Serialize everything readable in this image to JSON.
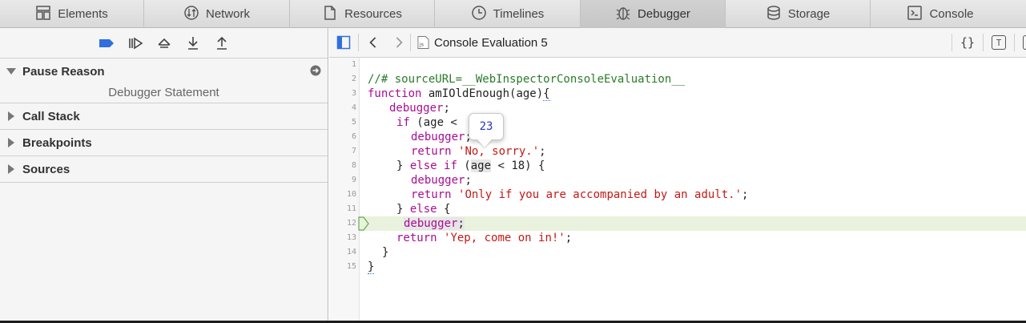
{
  "tabs": [
    {
      "label": "Elements",
      "icon": "elements-icon"
    },
    {
      "label": "Network",
      "icon": "network-icon"
    },
    {
      "label": "Resources",
      "icon": "resources-icon"
    },
    {
      "label": "Timelines",
      "icon": "timelines-icon"
    },
    {
      "label": "Debugger",
      "icon": "debugger-icon",
      "active": true
    },
    {
      "label": "Storage",
      "icon": "storage-icon"
    },
    {
      "label": "Console",
      "icon": "console-icon"
    }
  ],
  "sidebar": {
    "pause_reason": {
      "label": "Pause Reason",
      "detail": "Debugger Statement"
    },
    "sections": [
      "Call Stack",
      "Breakpoints",
      "Sources"
    ]
  },
  "editor": {
    "file_title": "Console Evaluation 5",
    "popover_value": "23",
    "current_line": 12,
    "line_numbers": [
      "1",
      "2",
      "3",
      "4",
      "5",
      "6",
      "7",
      "8",
      "9",
      "10",
      "11",
      "12",
      "13",
      "14",
      "15"
    ]
  },
  "code": {
    "l2": "//# sourceURL=__WebInspectorConsoleEvaluation__",
    "l3_kw": "function",
    "l3_name": " amIOldEnough(age)",
    "l3_brace": "{",
    "l4_kw": "debugger",
    "l4_rest": ";",
    "l5_kw": "if",
    "l5_rest": " (age < ",
    "l6_kw": "debugger",
    "l6_rest": ";",
    "l7_kw": "return",
    "l7_str": "'No, sorry.'",
    "l7_end": ";",
    "l8_a": "} ",
    "l8_kw1": "else",
    "l8_b": " ",
    "l8_kw2": "if",
    "l8_c": " (",
    "l8_var": "age",
    "l8_d": " < 18) {",
    "l9_kw": "debugger",
    "l9_rest": ";",
    "l10_kw": "return",
    "l10_str": "'Only if you are accompanied by an adult.'",
    "l10_end": ";",
    "l11_a": "} ",
    "l11_kw": "else",
    "l11_b": " {",
    "l12_kw": "debugger",
    "l12_rest": ";",
    "l13_kw": "return",
    "l13_str": "'Yep, come on in!'",
    "l13_end": ";",
    "l14": "}",
    "l15": "}"
  },
  "colors": {
    "keyword": "#a90d91",
    "comment": "#2a7b2a",
    "string": "#c41a16",
    "accent": "#2f6fde",
    "current_line": "#e8f2dd"
  }
}
